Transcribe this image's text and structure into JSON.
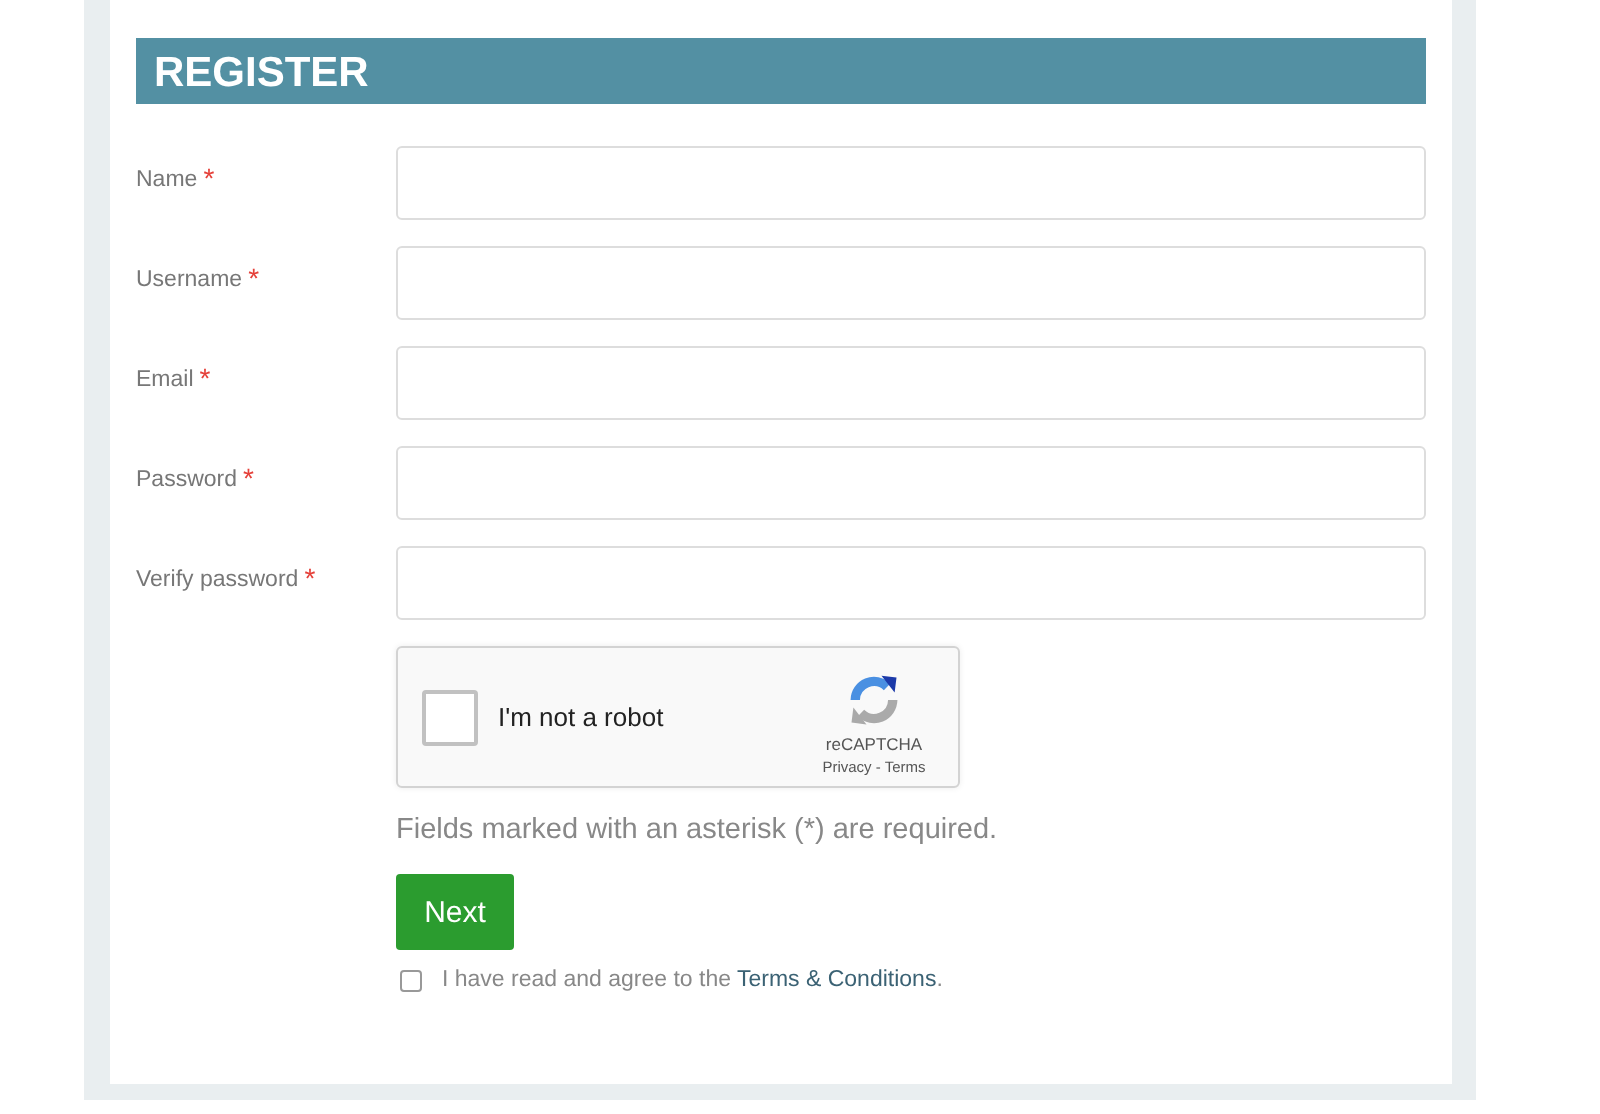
{
  "title": "REGISTER",
  "fields": [
    {
      "label": "Name",
      "mark": "*"
    },
    {
      "label": "Username",
      "mark": "*"
    },
    {
      "label": "Email",
      "mark": "*"
    },
    {
      "label": "Password",
      "mark": "*"
    },
    {
      "label": "Verify password",
      "mark": "*"
    }
  ],
  "captcha": {
    "label": "I'm not a robot",
    "checked": false,
    "brand": "reCAPTCHA",
    "links": "Privacy - Terms"
  },
  "note": "Fields marked with an asterisk (*) are required.",
  "button": "Next",
  "agree": {
    "checked": false,
    "before": "I have read and agree to the ",
    "link": "Terms & Conditions",
    "after": "."
  }
}
